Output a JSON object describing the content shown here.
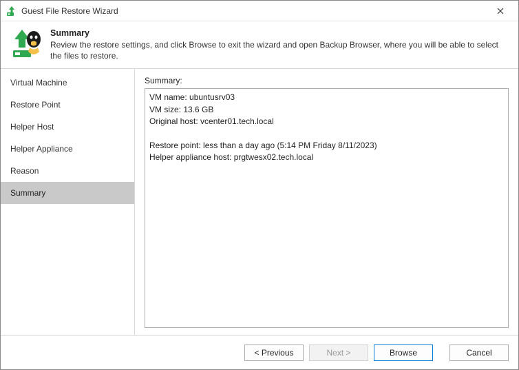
{
  "window": {
    "title": "Guest File Restore Wizard"
  },
  "header": {
    "title": "Summary",
    "description": "Review the restore settings, and click Browse to exit the wizard and open Backup Browser, where you will be able to select the files to restore."
  },
  "sidebar": {
    "items": [
      {
        "label": "Virtual Machine",
        "active": false
      },
      {
        "label": "Restore Point",
        "active": false
      },
      {
        "label": "Helper Host",
        "active": false
      },
      {
        "label": "Helper Appliance",
        "active": false
      },
      {
        "label": "Reason",
        "active": false
      },
      {
        "label": "Summary",
        "active": true
      }
    ]
  },
  "content": {
    "label": "Summary:",
    "summary_text": "VM name: ubuntusrv03\nVM size: 13.6 GB\nOriginal host: vcenter01.tech.local\n\nRestore point: less than a day ago (5:14 PM Friday 8/11/2023)\nHelper appliance host: prgtwesx02.tech.local"
  },
  "footer": {
    "previous": "< Previous",
    "next": "Next >",
    "browse": "Browse",
    "cancel": "Cancel"
  }
}
